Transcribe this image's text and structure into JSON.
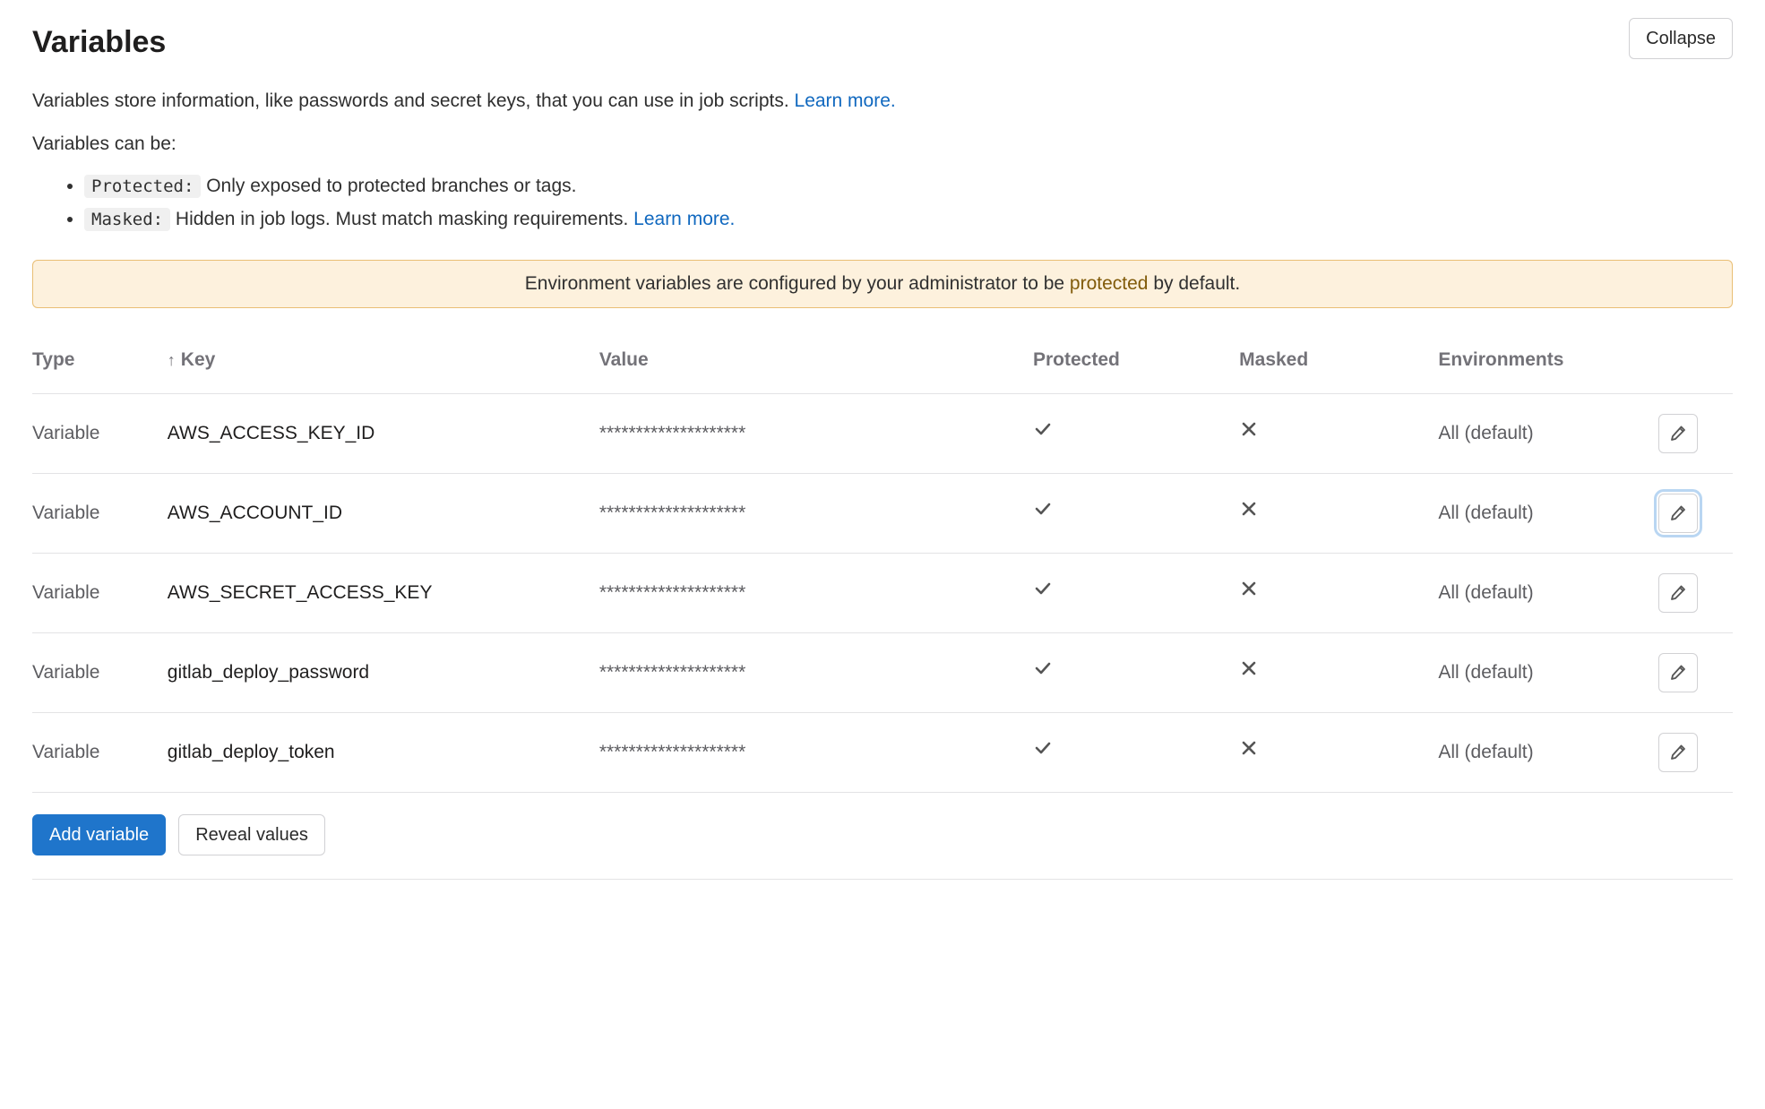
{
  "section": {
    "title": "Variables",
    "collapse_label": "Collapse",
    "intro_prefix": "Variables store information, like passwords and secret keys, that you can use in job scripts. ",
    "intro_link": "Learn more.",
    "types_lead": "Variables can be:",
    "protected_tag": "Protected:",
    "protected_desc": " Only exposed to protected branches or tags.",
    "masked_tag": "Masked:",
    "masked_desc": " Hidden in job logs. Must match masking requirements. ",
    "masked_link": "Learn more."
  },
  "notice": {
    "prefix": "Environment variables are configured by your administrator to be ",
    "link": "protected",
    "suffix": " by default."
  },
  "table": {
    "headers": {
      "type": "Type",
      "key": "Key",
      "value": "Value",
      "protected": "Protected",
      "masked": "Masked",
      "environments": "Environments"
    },
    "sort_arrow": "↑",
    "rows": [
      {
        "type": "Variable",
        "key": "AWS_ACCESS_KEY_ID",
        "value": "********************",
        "protected": true,
        "masked": false,
        "environments": "All (default)",
        "focused": false
      },
      {
        "type": "Variable",
        "key": "AWS_ACCOUNT_ID",
        "value": "********************",
        "protected": true,
        "masked": false,
        "environments": "All (default)",
        "focused": true
      },
      {
        "type": "Variable",
        "key": "AWS_SECRET_ACCESS_KEY",
        "value": "********************",
        "protected": true,
        "masked": false,
        "environments": "All (default)",
        "focused": false
      },
      {
        "type": "Variable",
        "key": "gitlab_deploy_password",
        "value": "********************",
        "protected": true,
        "masked": false,
        "environments": "All (default)",
        "focused": false
      },
      {
        "type": "Variable",
        "key": "gitlab_deploy_token",
        "value": "********************",
        "protected": true,
        "masked": false,
        "environments": "All (default)",
        "focused": false
      }
    ]
  },
  "actions": {
    "add": "Add variable",
    "reveal": "Reveal values"
  }
}
